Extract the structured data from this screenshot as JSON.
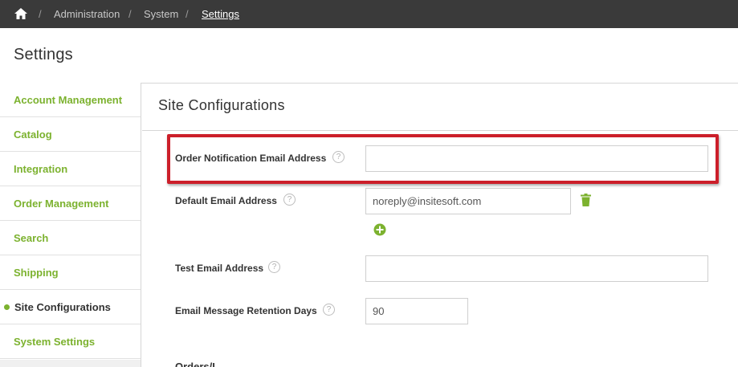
{
  "breadcrumb": {
    "separator": "/",
    "items": [
      "Administration",
      "System",
      "Settings"
    ]
  },
  "page": {
    "title": "Settings"
  },
  "sidebar": {
    "items": [
      {
        "label": "Account Management",
        "active": false
      },
      {
        "label": "Catalog",
        "active": false
      },
      {
        "label": "Integration",
        "active": false
      },
      {
        "label": "Order Management",
        "active": false
      },
      {
        "label": "Search",
        "active": false
      },
      {
        "label": "Shipping",
        "active": false
      },
      {
        "label": "Site Configurations",
        "active": true
      },
      {
        "label": "System Settings",
        "active": false
      }
    ]
  },
  "main": {
    "section_title": "Site Configurations",
    "help_glyph": "?",
    "fields": {
      "order_notification": {
        "label": "Order Notification Email Address",
        "value": ""
      },
      "default_email": {
        "label": "Default Email Address",
        "value": "noreply@insitesoft.com"
      },
      "test_email": {
        "label": "Test Email Address",
        "value": ""
      },
      "retention_days": {
        "label": "Email Message Retention Days",
        "value": "90"
      }
    },
    "next_section_partial": "Orders/I"
  },
  "colors": {
    "accent_green": "#7cb22f",
    "topbar": "#3a3a3a",
    "highlight_red": "#cc1f2a"
  },
  "icons": {
    "home": "home-icon",
    "help": "help-circle-icon",
    "delete": "trash-icon",
    "add": "plus-circle-icon"
  }
}
